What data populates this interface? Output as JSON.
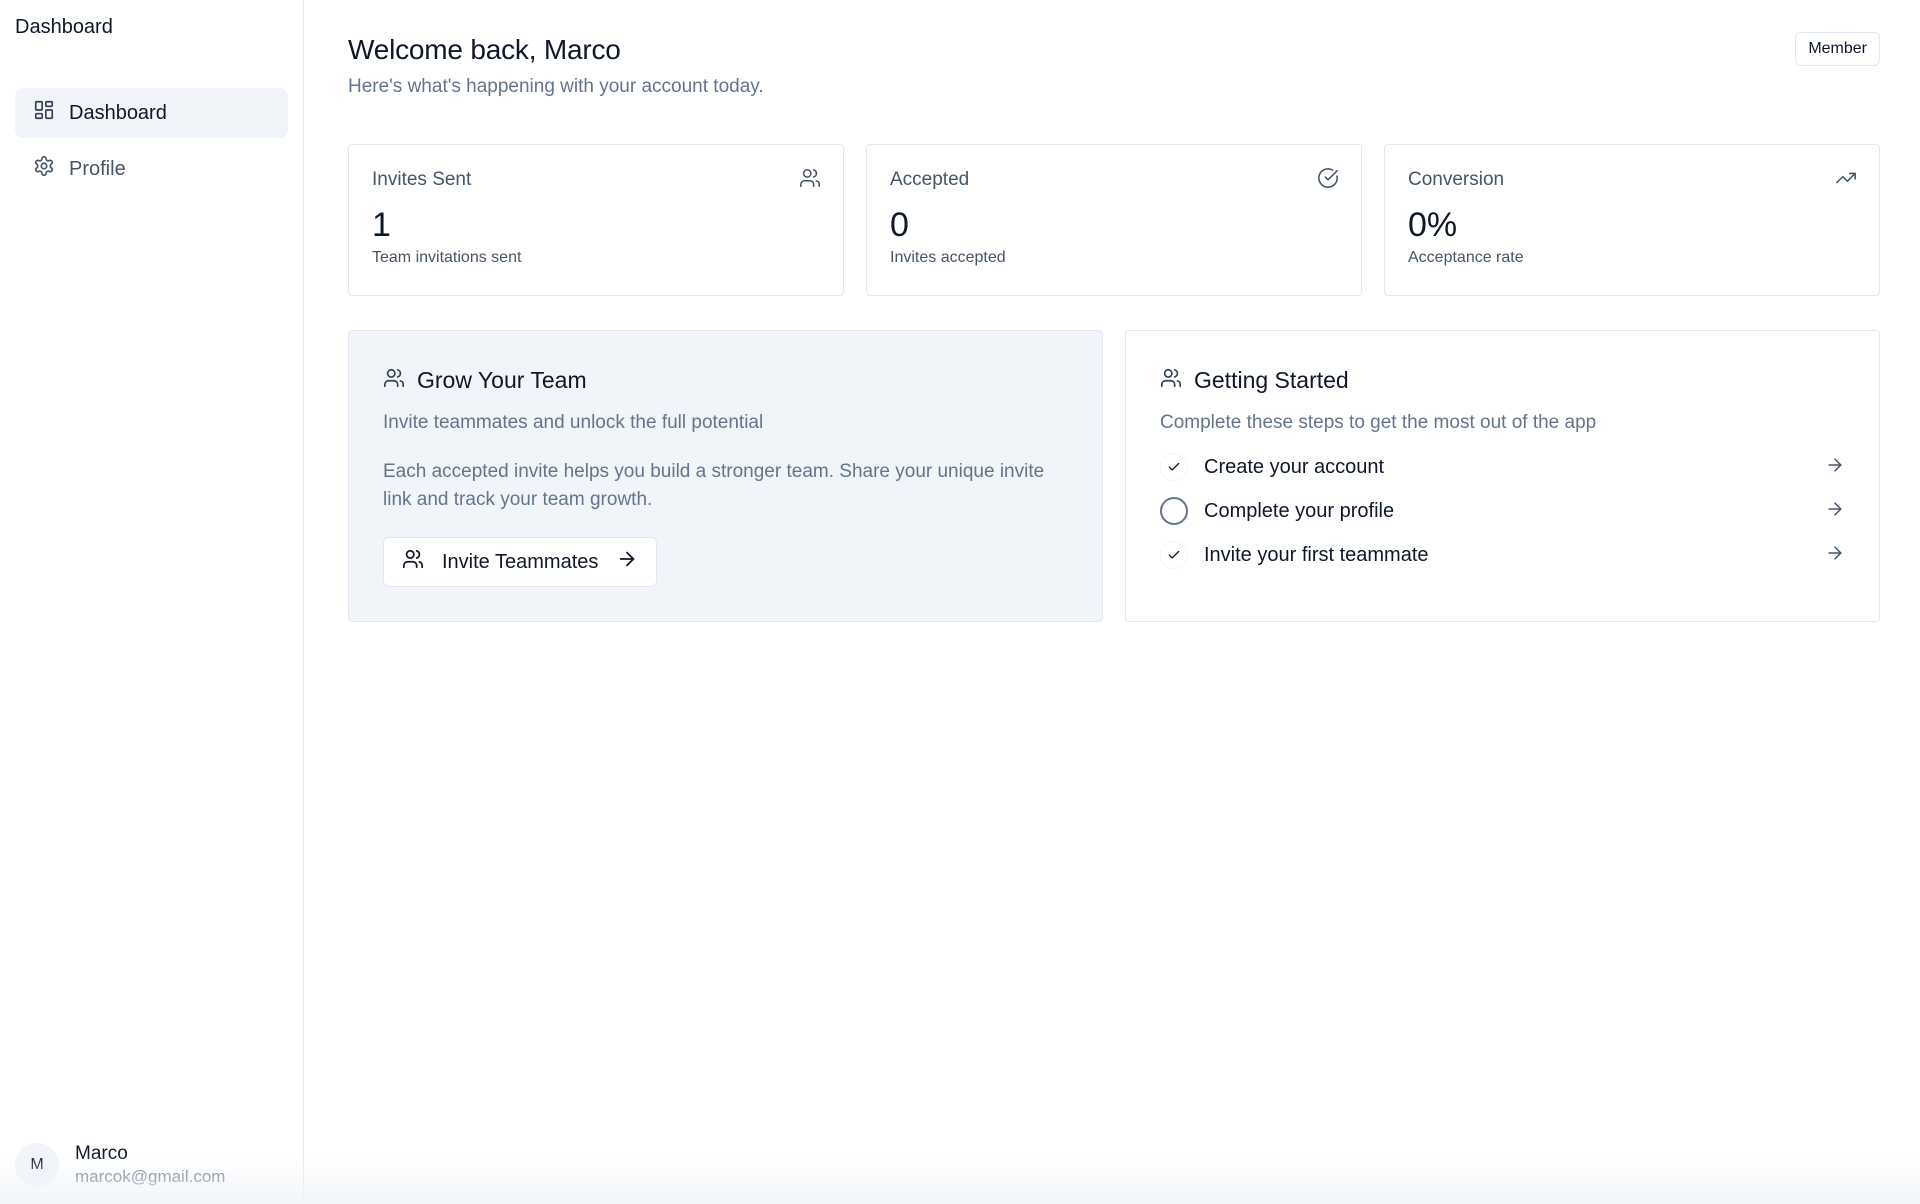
{
  "sidebar": {
    "title": "Dashboard",
    "items": [
      {
        "label": "Dashboard",
        "icon": "layout-grid-icon",
        "active": true
      },
      {
        "label": "Profile",
        "icon": "gear-icon",
        "active": false
      }
    ],
    "user": {
      "initial": "M",
      "name": "Marco",
      "email": "marcok@gmail.com"
    }
  },
  "header": {
    "title": "Welcome back, Marco",
    "subtitle": "Here's what's happening with your account today.",
    "role_badge": "Member"
  },
  "stats": [
    {
      "label": "Invites Sent",
      "value": "1",
      "description": "Team invitations sent",
      "icon": "users-icon"
    },
    {
      "label": "Accepted",
      "value": "0",
      "description": "Invites accepted",
      "icon": "check-circle-icon"
    },
    {
      "label": "Conversion",
      "value": "0%",
      "description": "Acceptance rate",
      "icon": "trending-up-icon"
    }
  ],
  "grow_team": {
    "title": "Grow Your Team",
    "subtitle": "Invite teammates and unlock the full potential",
    "body": "Each accepted invite helps you build a stronger team. Share your unique invite link and track your team growth.",
    "button_label": "Invite Teammates"
  },
  "getting_started": {
    "title": "Getting Started",
    "subtitle": "Complete these steps to get the most out of the app",
    "steps": [
      {
        "label": "Create your account",
        "done": true
      },
      {
        "label": "Complete your profile",
        "done": false
      },
      {
        "label": "Invite your first teammate",
        "done": true
      }
    ]
  },
  "colors": {
    "text": "#0f172a",
    "muted": "#64748b",
    "border": "#e2e8f0",
    "highlight": "#f1f5f9"
  }
}
